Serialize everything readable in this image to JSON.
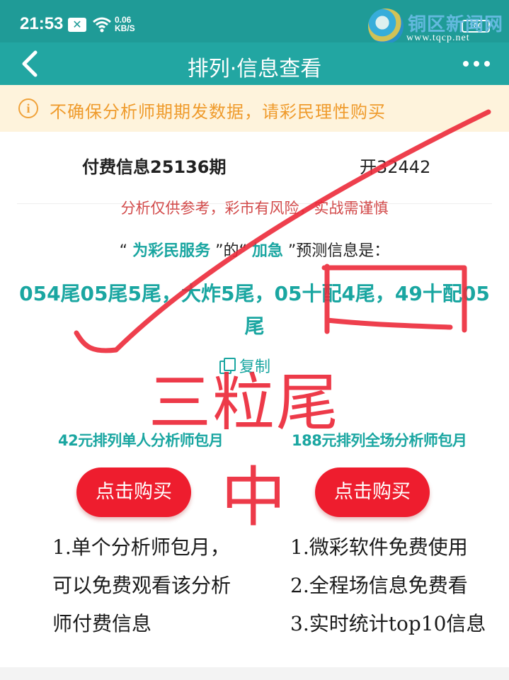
{
  "status_bar": {
    "time": "21:53",
    "notification_badge": "✕",
    "net_speed_value": "0.06",
    "net_speed_unit": "KB/S",
    "battery": "100"
  },
  "watermark": {
    "name": "铜区新闻网",
    "url": "www.tqcp.net"
  },
  "nav": {
    "title": "排列·信息查看"
  },
  "warning": {
    "icon": "i",
    "text": "不确保分析师期期发数据，请彩民理性购买"
  },
  "issue": {
    "title": "付费信息25136期",
    "open_result": "开32442"
  },
  "risk_notice": "分析仅供参考，彩市有风险，实战需谨慎",
  "prediction": {
    "quote_open": "“",
    "service": "为彩民服务",
    "mid": "”的“",
    "analyst": "加急",
    "tail": "”预测信息是：",
    "content": "054尾05尾5尾，大炸5尾，05十配4尾，49十配05尾"
  },
  "copy_label": "复制",
  "plans": [
    {
      "title": "42元排列单人分析师包月",
      "button": "点击购买",
      "desc": [
        "1.单个分析师包月，",
        "可以免费观看该分析",
        "师付费信息"
      ]
    },
    {
      "title": "188元排列全场分析师包月",
      "button": "点击购买",
      "desc": [
        "1.微彩软件免费使用",
        "2.全程场信息免费看",
        "3.实时统计top10信息"
      ]
    }
  ],
  "annotation": {
    "big_text": "三粒尾",
    "mid_text": "中",
    "color": "#ec2a3a"
  },
  "colors": {
    "teal": "#22a6a2",
    "accent_teal": "#1aa6a1",
    "warning_bg": "#fef3dc",
    "warning_text": "#ef9b2c",
    "buy_red": "#ee1d2e",
    "risk_red": "#d24a4a"
  }
}
